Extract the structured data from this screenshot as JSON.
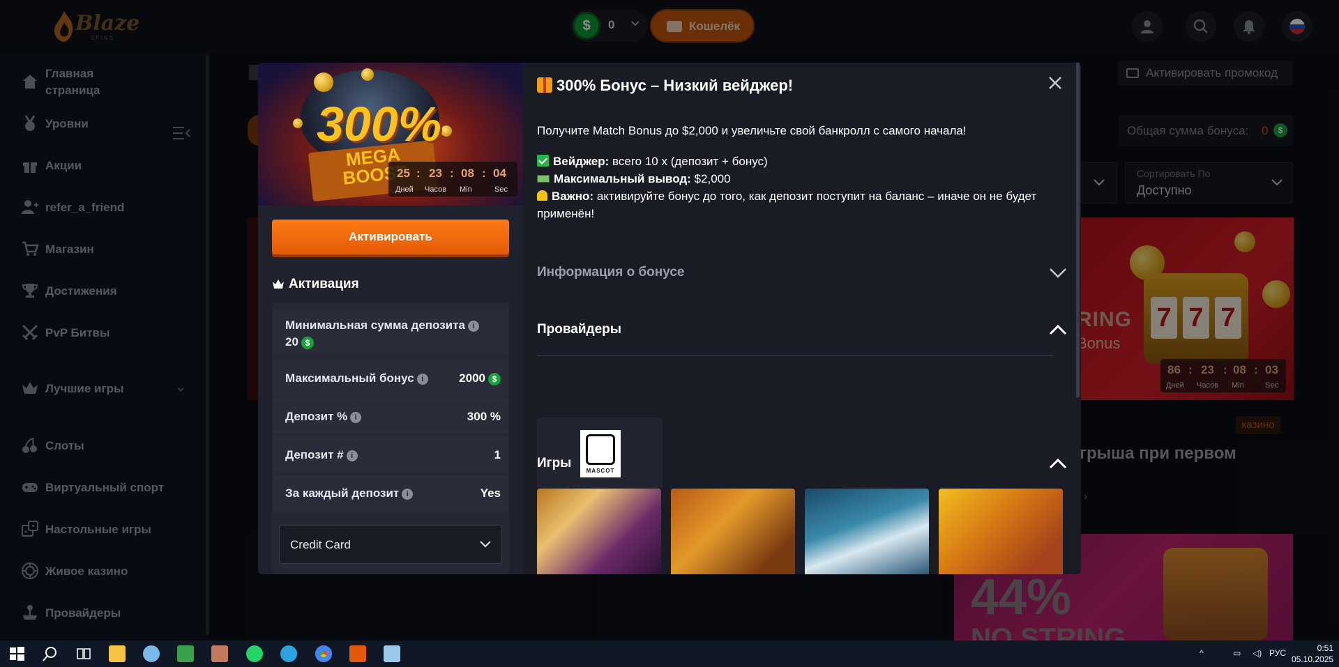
{
  "header": {
    "logo_text": "Blaze",
    "logo_sub": "SPINS",
    "balance_value": "0",
    "wallet_label": "Кошелёк"
  },
  "sidebar": {
    "items": [
      {
        "label": "Главная страница",
        "icon": "home-icon"
      },
      {
        "label": "Уровни",
        "icon": "medal-icon"
      },
      {
        "label": "Акции",
        "icon": "gift-icon"
      },
      {
        "label": "refer_a_friend",
        "icon": "user-plus-icon"
      },
      {
        "label": "Магазин",
        "icon": "cart-icon"
      },
      {
        "label": "Достижения",
        "icon": "trophy-icon"
      },
      {
        "label": "PvP Битвы",
        "icon": "swords-icon"
      },
      {
        "label": "Лучшие игры",
        "icon": "crown-icon"
      },
      {
        "label": "Слоты",
        "icon": "cherry-icon"
      },
      {
        "label": "Виртуальный спорт",
        "icon": "gamepad-icon"
      },
      {
        "label": "Настольные игры",
        "icon": "dice-icon"
      },
      {
        "label": "Живое казино",
        "icon": "chip-icon"
      },
      {
        "label": "Провайдеры",
        "icon": "joystick-icon"
      }
    ]
  },
  "background": {
    "promo_label": "Активировать промокод",
    "total_bonus_label": "Общая сумма бонуса:",
    "total_bonus_value": "0",
    "sort_label": "Сортировать По",
    "sort_value": "Доступно",
    "card_text1": "RING",
    "card_text2": "Bonus",
    "card_timer": {
      "d": "86",
      "h": "23",
      "m": "08",
      "s": "03"
    },
    "timer_labels": {
      "d": "Дней",
      "h": "Часов",
      "m": "Min",
      "s": "Sec"
    },
    "casino_badge": "казино",
    "card_title_fragment": "грыша при первом",
    "pink_pct": "44%",
    "pink_sub": "NO STRING"
  },
  "modal": {
    "banner_big": "300%",
    "banner_mega": "MEGA",
    "banner_boost": "BOOST",
    "timer": {
      "d": "25",
      "h": "23",
      "m": "08",
      "s": "04"
    },
    "activate_label": "Активировать",
    "activation_title": "Активация",
    "rows": [
      {
        "label": "Минимальная сумма депозита",
        "value": "20"
      },
      {
        "label": "Максимальный бонус",
        "value": "2000"
      },
      {
        "label": "Депозит %",
        "value": "300 %"
      },
      {
        "label": "Депозит #",
        "value": "1"
      },
      {
        "label": "За каждый депозит",
        "value": "Yes"
      }
    ],
    "payment_method": "Credit Card",
    "title": "300% Бонус – Низкий вейджер!",
    "description": "Получите Match Bonus до $2,000 и увеличьте свой банкролл с самого начала!",
    "wager_label": "Вейджер:",
    "wager_text": "всего 10 x (депозит + бонус)",
    "max_label": "Максимальный вывод:",
    "max_text": "$2,000",
    "important_label": "Важно:",
    "important_text1": "активируйте бонус до того, как депозит поступит на баланс – иначе он не будет",
    "important_text2": "применён!",
    "bonus_info": "Информация о бонусе",
    "providers_title": "Провайдеры",
    "provider_logo_text": "MASCOT",
    "games_title": "Игры"
  },
  "taskbar": {
    "lang": "РУС",
    "time": "0:51",
    "date": "05.10.2025"
  },
  "colors": {
    "accent_orange": "#e35a06",
    "coin_green": "#1aa33c",
    "modal_bg": "#1a1c25"
  }
}
